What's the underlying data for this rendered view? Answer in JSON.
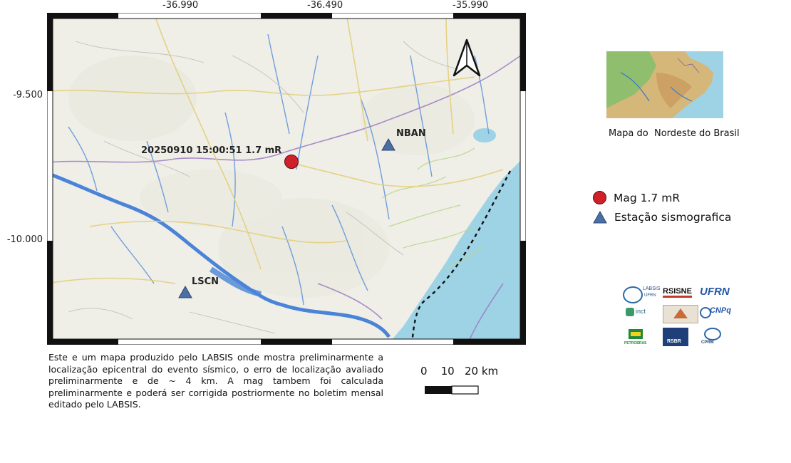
{
  "map": {
    "x_ticks": [
      "-36.990",
      "-36.490",
      "-35.990"
    ],
    "y_ticks": [
      "-9.500",
      "-10.000"
    ],
    "event_label": "20250910 15:00:51 1.7 mR",
    "stations": [
      {
        "code": "NBAN"
      },
      {
        "code": "LSCN"
      }
    ],
    "colors": {
      "event": "#d0202a",
      "station": "#4a6fa5",
      "ocean": "#9ed3e6",
      "land": "#eeede6"
    }
  },
  "inset": {
    "caption": "Mapa do  Nordeste do Brasil"
  },
  "legend": {
    "items": [
      {
        "label": "Mag 1.7 mR",
        "symbol": "red-circle"
      },
      {
        "label": "Estação sismografica",
        "symbol": "blue-triangle"
      }
    ]
  },
  "scale": {
    "labels": "0    10   20 km"
  },
  "description": "Este e um mapa produzido pelo LABSIS onde mostra preliminarmente a localização epicentral do evento sísmico, o erro de localização avaliado preliminarmente e de ~ 4 km. A mag tambem foi calculada preliminarmente e poderá ser corrigida postriormente no boletim mensal editado pelo LABSIS.",
  "logos": {
    "labsis": "LABSIS",
    "labsis_sub": "UFRN",
    "rsisne": "RSISNE",
    "ufrn": "UFRN",
    "inct": "inct",
    "cnpq": "CNPq",
    "petrobras": "PETROBRAS",
    "rsbr": "RSBR",
    "cprm": "CPRM"
  }
}
